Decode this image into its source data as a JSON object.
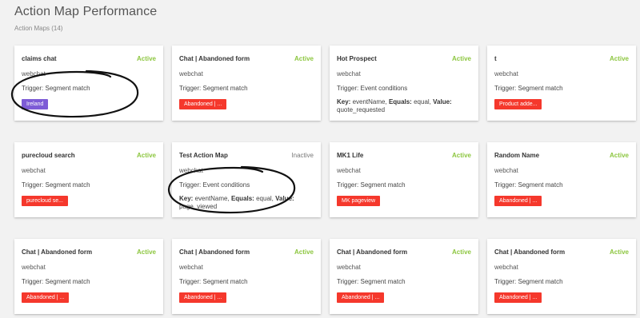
{
  "header": {
    "title": "Action Map Performance",
    "subtitle": "Action Maps (14)"
  },
  "colors": {
    "active": "#8cc63f",
    "inactive": "#777777",
    "tag_red": "#f5382c",
    "tag_purple": "#7d5bd6",
    "annotation": "#111111"
  },
  "cards": [
    {
      "name": "claims chat",
      "status": "Active",
      "channel": "webchat",
      "trigger": "Trigger: Segment match",
      "tag": "Ireland",
      "tag_color": "purple"
    },
    {
      "name": "Chat | Abandoned form",
      "status": "Active",
      "channel": "webchat",
      "trigger": "Trigger: Segment match",
      "tag": "Abandoned | ...",
      "tag_color": "red"
    },
    {
      "name": "Hot Prospect",
      "status": "Active",
      "channel": "webchat",
      "trigger": "Trigger: Event conditions",
      "detail": {
        "key_label": "Key:",
        "key": "eventName,",
        "equals_label": "Equals:",
        "equals": "equal,",
        "value_label": "Value:",
        "value": "quote_requested"
      }
    },
    {
      "name": "t",
      "status": "Active",
      "channel": "webchat",
      "trigger": "Trigger: Segment match",
      "tag": "Product adde...",
      "tag_color": "red"
    },
    {
      "name": "purecloud search",
      "status": "Active",
      "channel": "webchat",
      "trigger": "Trigger: Segment match",
      "tag": "purecloud se...",
      "tag_color": "red"
    },
    {
      "name": "Test Action Map",
      "status": "Inactive",
      "channel": "webchat",
      "trigger": "Trigger: Event conditions",
      "detail": {
        "key_label": "Key:",
        "key": "eventName,",
        "equals_label": "Equals:",
        "equals": "equal,",
        "value_label": "Value:",
        "value": "page_viewed"
      }
    },
    {
      "name": "MK1 Life",
      "status": "Active",
      "channel": "webchat",
      "trigger": "Trigger: Segment match",
      "tag": "MK pageview",
      "tag_color": "red"
    },
    {
      "name": "Random Name",
      "status": "Active",
      "channel": "webchat",
      "trigger": "Trigger: Segment match",
      "tag": "Abandoned | ...",
      "tag_color": "red"
    },
    {
      "name": "Chat | Abandoned form",
      "status": "Active",
      "channel": "webchat",
      "trigger": "Trigger: Segment match",
      "tag": "Abandoned | ...",
      "tag_color": "red"
    },
    {
      "name": "Chat | Abandoned form",
      "status": "Active",
      "channel": "webchat",
      "trigger": "Trigger: Segment match",
      "tag": "Abandoned | ...",
      "tag_color": "red"
    },
    {
      "name": "Chat | Abandoned form",
      "status": "Active",
      "channel": "webchat",
      "trigger": "Trigger: Segment match",
      "tag": "Abandoned | ...",
      "tag_color": "red"
    },
    {
      "name": "Chat | Abandoned form",
      "status": "Active",
      "channel": "webchat",
      "trigger": "Trigger: Segment match",
      "tag": "Abandoned | ...",
      "tag_color": "red"
    }
  ]
}
